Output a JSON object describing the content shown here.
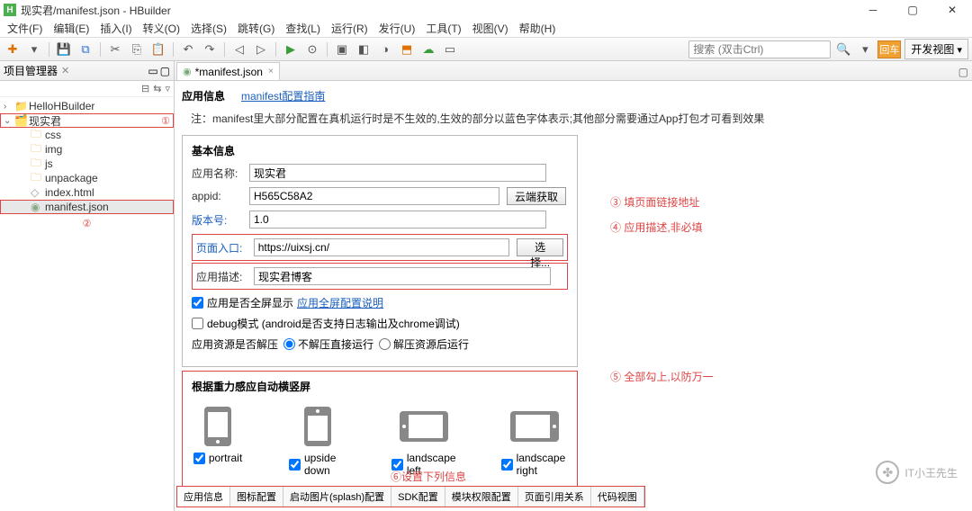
{
  "window": {
    "title": "现实君/manifest.json  -  HBuilder",
    "logo_letter": "H"
  },
  "menubar": [
    "文件(F)",
    "编辑(E)",
    "插入(I)",
    "转义(O)",
    "选择(S)",
    "跳转(G)",
    "查找(L)",
    "运行(R)",
    "发行(U)",
    "工具(T)",
    "视图(V)",
    "帮助(H)"
  ],
  "toolbar": {
    "search_placeholder": "搜索 (双击Ctrl)",
    "go_label": "回车",
    "perspective_label": "开发视图"
  },
  "sidebar": {
    "panel_title": "项目管理器",
    "items": [
      {
        "label": "HelloHBuilder",
        "icon": "folder",
        "indent": 0,
        "arrow": ">"
      },
      {
        "label": "现实君",
        "icon": "project",
        "indent": 0,
        "arrow": "v",
        "outlined": true,
        "annot": "①"
      },
      {
        "label": "css",
        "icon": "folder",
        "indent": 2,
        "arrow": ""
      },
      {
        "label": "img",
        "icon": "folder",
        "indent": 2,
        "arrow": ""
      },
      {
        "label": "js",
        "icon": "folder",
        "indent": 2,
        "arrow": ""
      },
      {
        "label": "unpackage",
        "icon": "folder",
        "indent": 2,
        "arrow": ""
      },
      {
        "label": "index.html",
        "icon": "html",
        "indent": 2,
        "arrow": ""
      },
      {
        "label": "manifest.json",
        "icon": "json",
        "indent": 2,
        "arrow": "",
        "selected": true,
        "outlined": true
      }
    ],
    "annot2": "②"
  },
  "editor": {
    "tab_label": "*manifest.json",
    "top_link1": "应用信息",
    "top_link2": "manifest配置指南",
    "note": "注：manifest里大部分配置在真机运行时是不生效的,生效的部分以蓝色字体表示;其他部分需要通过App打包才可看到效果",
    "basic_legend": "基本信息",
    "fields": {
      "app_name_label": "应用名称:",
      "app_name_value": "现实君",
      "appid_label": "appid:",
      "appid_value": "H565C58A2",
      "cloud_btn": "云端获取",
      "version_label": "版本号:",
      "version_value": "1.0",
      "entry_label": "页面入口:",
      "entry_value": "https://uixsj.cn/",
      "choose_btn": "选择...",
      "desc_label": "应用描述:",
      "desc_value": "现实君博客"
    },
    "checks": {
      "fullscreen_label": "应用是否全屏显示",
      "fullscreen_link": "应用全屏配置说明",
      "debug_label": "debug模式 (android是否支持日志输出及chrome调试)",
      "resource_label": "应用资源是否解压",
      "radio1": "不解压直接运行",
      "radio2": "解压资源后运行"
    },
    "orient": {
      "legend": "根据重力感应自动横竖屏",
      "items": [
        "portrait",
        "upside down",
        "landscape left",
        "landscape right"
      ]
    },
    "bottom_tabs": [
      "应用信息",
      "图标配置",
      "启动图片(splash)配置",
      "SDK配置",
      "模块权限配置",
      "页面引用关系",
      "代码视图"
    ]
  },
  "annotations": {
    "a3": "③ 填页面链接地址",
    "a4": "④ 应用描述,非必填",
    "a5": "⑤ 全部勾上,以防万一",
    "a6": "⑥设置下列信息"
  },
  "watermark": {
    "text": "IT小王先生"
  }
}
